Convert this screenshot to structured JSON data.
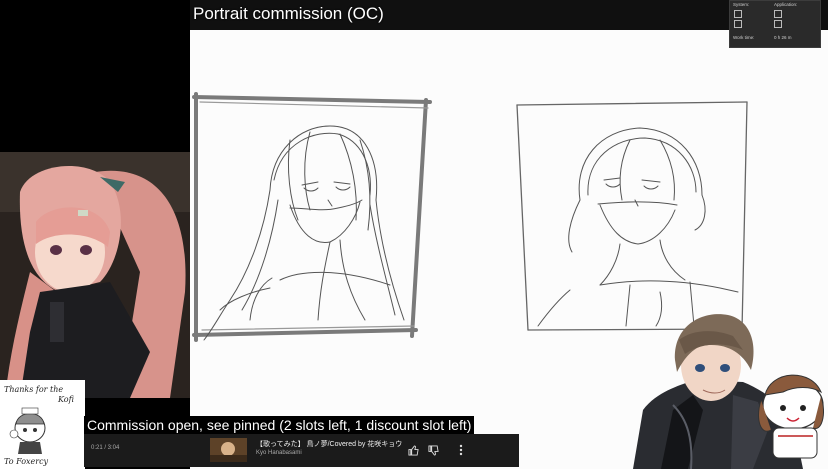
{
  "stream": {
    "title": "Portrait commission (OC)",
    "caption": "Commission open, see pinned (2 slots left, 1 discount slot left)"
  },
  "stats": {
    "system_label": "System:",
    "application_label": "Application:",
    "worktime_label": "Work time:",
    "worktime_value": "0 h 26 m"
  },
  "music_player": {
    "time": "0:21 / 3:04",
    "title": "【歌ってみた】 鳥ノ夢/Covered by 花咲キョウ",
    "artist": "Kyo Hanabasami",
    "like_icon": "thumbs-up-icon",
    "dislike_icon": "thumbs-down-icon",
    "more_icon": "more-vertical-icon"
  },
  "fan_art": {
    "line1": "Thanks for the",
    "line2": "Kofi",
    "line3": "To Foxercy"
  },
  "colors": {
    "canvas": "#fcfcfc",
    "sketch_line": "#555555",
    "frame_line": "#777777"
  }
}
